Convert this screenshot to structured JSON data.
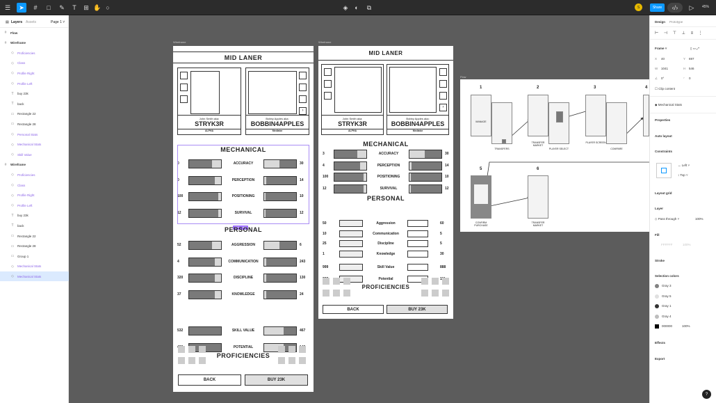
{
  "toolbar": {
    "share_label": "Share",
    "zoom": "45%",
    "user_initial": "S"
  },
  "left_panel": {
    "tabs": [
      "Layers",
      "Assets"
    ],
    "page": "Page 1",
    "layers": [
      {
        "label": "Flow",
        "indent": 0,
        "type": "frame"
      },
      {
        "label": "Wireframe",
        "indent": 0,
        "type": "frame"
      },
      {
        "label": "Proficiencies",
        "indent": 1,
        "type": "comp"
      },
      {
        "label": "Class",
        "indent": 1,
        "type": "comp"
      },
      {
        "label": "Profile Right",
        "indent": 1,
        "type": "comp"
      },
      {
        "label": "Profile Left",
        "indent": 1,
        "type": "comp"
      },
      {
        "label": "buy 23k",
        "indent": 1,
        "type": "text"
      },
      {
        "label": "back",
        "indent": 1,
        "type": "text"
      },
      {
        "label": "Rectangle 22",
        "indent": 1,
        "type": "rect"
      },
      {
        "label": "Rectangle 28",
        "indent": 1,
        "type": "rect"
      },
      {
        "label": "Personal Stats",
        "indent": 1,
        "type": "comp"
      },
      {
        "label": "Mechanical Stats",
        "indent": 1,
        "type": "comp"
      },
      {
        "label": "Skill Value",
        "indent": 1,
        "type": "comp"
      },
      {
        "label": "Wireframe",
        "indent": 0,
        "type": "frame"
      },
      {
        "label": "Proficiencies",
        "indent": 1,
        "type": "comp"
      },
      {
        "label": "Class",
        "indent": 1,
        "type": "comp"
      },
      {
        "label": "Profile Right",
        "indent": 1,
        "type": "comp"
      },
      {
        "label": "Profile Left",
        "indent": 1,
        "type": "comp"
      },
      {
        "label": "buy 23k",
        "indent": 1,
        "type": "text"
      },
      {
        "label": "back",
        "indent": 1,
        "type": "text"
      },
      {
        "label": "Rectangle 22",
        "indent": 1,
        "type": "rect"
      },
      {
        "label": "Rectangle 28",
        "indent": 1,
        "type": "rect"
      },
      {
        "label": "Group 1",
        "indent": 1,
        "type": "group"
      },
      {
        "label": "Mechanical Stats",
        "indent": 1,
        "type": "comp"
      },
      {
        "label": "Mechanical Stats",
        "indent": 1,
        "type": "comp",
        "selected": true
      }
    ]
  },
  "canvas": {
    "frame_labels": {
      "wire1": "Wireframe",
      "wire2": "Wireframe",
      "flow": "Flow"
    },
    "title": "MID LANER",
    "player_left": {
      "aka": "John Smith aka:",
      "name": "STRYK3R",
      "tag": "ALPHA"
    },
    "player_right": {
      "aka": "Bobby Apples aka:",
      "name": "BOBBIN4APPLES",
      "tag": "Mediator"
    },
    "mechanical_title": "MECHANICAL",
    "personal_title": "PERSONAL",
    "proficiencies_title": "PROFICIENCIES",
    "back_label": "BACK",
    "buy_label": "BUY 23K",
    "size_badge": "1041 × 546",
    "wire1_mech": [
      {
        "left": "0",
        "label": "ACCURACY",
        "right": "30",
        "l": 0.72,
        "r": 0.48
      },
      {
        "left": "0",
        "label": "PERCEPTION",
        "right": "14",
        "l": 0.8,
        "r": 0.06
      },
      {
        "left": "100",
        "label": "POSITIONING",
        "right": "10",
        "l": 0.92,
        "r": 0.04
      },
      {
        "left": "12",
        "label": "SURVIVAL",
        "right": "12",
        "l": 0.92,
        "r": 0.04
      }
    ],
    "wire1_pers": [
      {
        "left": "52",
        "label": "AGGRESSION",
        "right": "6",
        "l": 0.72,
        "r": 0.48
      },
      {
        "left": "4",
        "label": "COMMUNICATION",
        "right": "243",
        "l": 0.8,
        "r": 0.06
      },
      {
        "left": "320",
        "label": "DISCIPLINE",
        "right": "130",
        "l": 0.8,
        "r": 0.06
      },
      {
        "left": "37",
        "label": "KNOWLEDGE",
        "right": "24",
        "l": 0.8,
        "r": 0.06
      }
    ],
    "wire1_extra": [
      {
        "left": "532",
        "label": "SKILL VALUE",
        "right": "467",
        "l": 1,
        "r": 0.6
      },
      {
        "left": "460",
        "label": "POTENTIAL",
        "right": "140",
        "l": 1,
        "r": 0.6
      }
    ],
    "wire2_mech": [
      {
        "left": "3",
        "label": "ACCURACY",
        "right": "30",
        "l": 0.72,
        "r": 0.48
      },
      {
        "left": "4",
        "label": "PERCEPTION",
        "right": "14",
        "l": 0.8,
        "r": 0.06
      },
      {
        "left": "100",
        "label": "POSITIONING",
        "right": "10",
        "l": 0.92,
        "r": 0.04
      },
      {
        "left": "12",
        "label": "SURVIVAL",
        "right": "12",
        "l": 0.92,
        "r": 0.04
      }
    ],
    "wire2_pers": [
      {
        "left": "50",
        "label": "Aggression",
        "right": "60"
      },
      {
        "left": "10",
        "label": "Communication",
        "right": "5"
      },
      {
        "left": "25",
        "label": "Discipline",
        "right": "5"
      },
      {
        "left": "1",
        "label": "Knowledge",
        "right": "30"
      }
    ],
    "wire2_extra": [
      {
        "left": "999",
        "label": "Skill Value",
        "right": "888"
      },
      {
        "left": "222",
        "label": "Potential",
        "right": "111"
      }
    ],
    "flow_steps": [
      {
        "num": "1",
        "caps": [
          "MANAGE",
          "TRANSFERS"
        ]
      },
      {
        "num": "2",
        "caps": [
          "TRANSFER MARKET",
          "PLAYER SELECT"
        ]
      },
      {
        "num": "3",
        "caps": [
          "PLAYER SCREEN",
          "COMPARE"
        ]
      },
      {
        "num": "4",
        "caps": [
          "CO..."
        ]
      },
      {
        "num": "5",
        "caps": [
          "CONFIRM PURCHASE"
        ]
      },
      {
        "num": "6",
        "caps": [
          "TRANSFER MARKET"
        ]
      }
    ]
  },
  "right_panel": {
    "tabs": [
      "Design",
      "Prototype"
    ],
    "frame_label": "Frame",
    "x": "40",
    "y": "697",
    "w": "1041",
    "h": "546",
    "rotation": "0°",
    "radius": "0",
    "clip_content": "Clip content",
    "component": "Mechanical Stats",
    "sections": [
      "Properties",
      "Auto layout",
      "Constraints",
      "Layout grid",
      "Layer",
      "Fill",
      "Stroke",
      "Selection colors",
      "Effects",
      "Export"
    ],
    "constraint_h": "Left",
    "constraint_v": "Top",
    "layer_mode": "Pass through",
    "layer_opacity": "100%",
    "fill_value": "FFFFFF",
    "fill_opacity": "100%",
    "colors": [
      {
        "name": "Gray 3",
        "hex": "#828282"
      },
      {
        "name": "Gray 5",
        "hex": "#e0e0e0"
      },
      {
        "name": "Gray 1",
        "hex": "#333333"
      },
      {
        "name": "Gray 4",
        "hex": "#bdbdbd"
      },
      {
        "name": "000000",
        "hex": "#000000",
        "opacity": "100%"
      }
    ]
  }
}
